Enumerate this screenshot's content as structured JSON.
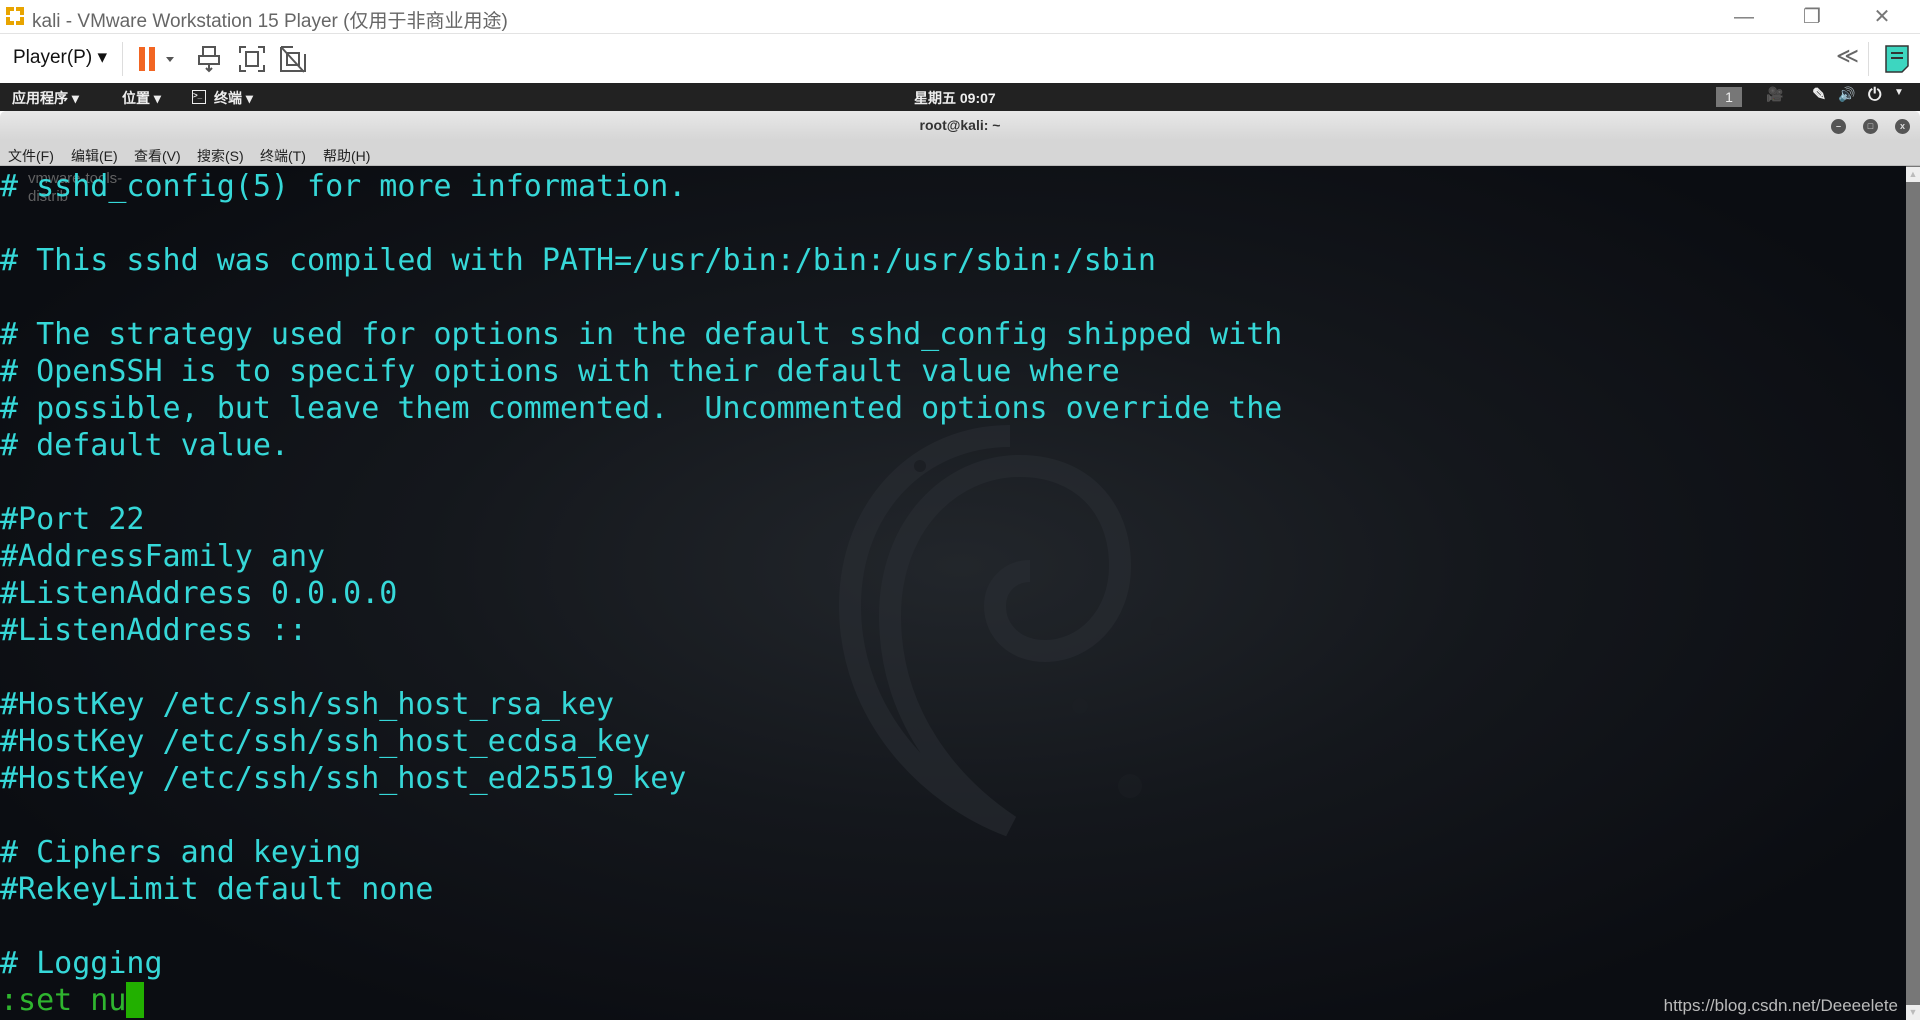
{
  "window": {
    "title": "kali - VMware Workstation 15 Player (仅用于非商业用途)",
    "minimize": "—",
    "restore": "❐",
    "close": "✕"
  },
  "toolbar": {
    "player_menu": "Player(P) ▾",
    "collapse": "≪",
    "colors": {
      "pause": "#f26522",
      "note": "#3dd6c0"
    }
  },
  "gnome_bar": {
    "applications": "应用程序 ▾",
    "places": "位置 ▾",
    "terminal": "终端 ▾",
    "clock": "星期五 09:07",
    "workspace": "1"
  },
  "terminal": {
    "title": "root@kali: ~",
    "menu": [
      "文件(F)",
      "编辑(E)",
      "查看(V)",
      "搜索(S)",
      "终端(T)",
      "帮助(H)"
    ],
    "overlay_text": "vmware-tools-\ndistrib",
    "lines": [
      "# sshd_config(5) for more information.",
      "",
      "# This sshd was compiled with PATH=/usr/bin:/bin:/usr/sbin:/sbin",
      "",
      "# The strategy used for options in the default sshd_config shipped with",
      "# OpenSSH is to specify options with their default value where",
      "# possible, but leave them commented.  Uncommented options override the",
      "# default value.",
      "",
      "#Port 22",
      "#AddressFamily any",
      "#ListenAddress 0.0.0.0",
      "#ListenAddress ::",
      "",
      "#HostKey /etc/ssh/ssh_host_rsa_key",
      "#HostKey /etc/ssh/ssh_host_ecdsa_key",
      "#HostKey /etc/ssh/ssh_host_ed25519_key",
      "",
      "# Ciphers and keying",
      "#RekeyLimit default none",
      "",
      "# Logging"
    ],
    "command_line": ":set nu",
    "colors": {
      "text": "#36d8d8",
      "command": "#2fb52f",
      "cursor": "#22b000"
    }
  },
  "watermark": "https://blog.csdn.net/Deeeelete"
}
